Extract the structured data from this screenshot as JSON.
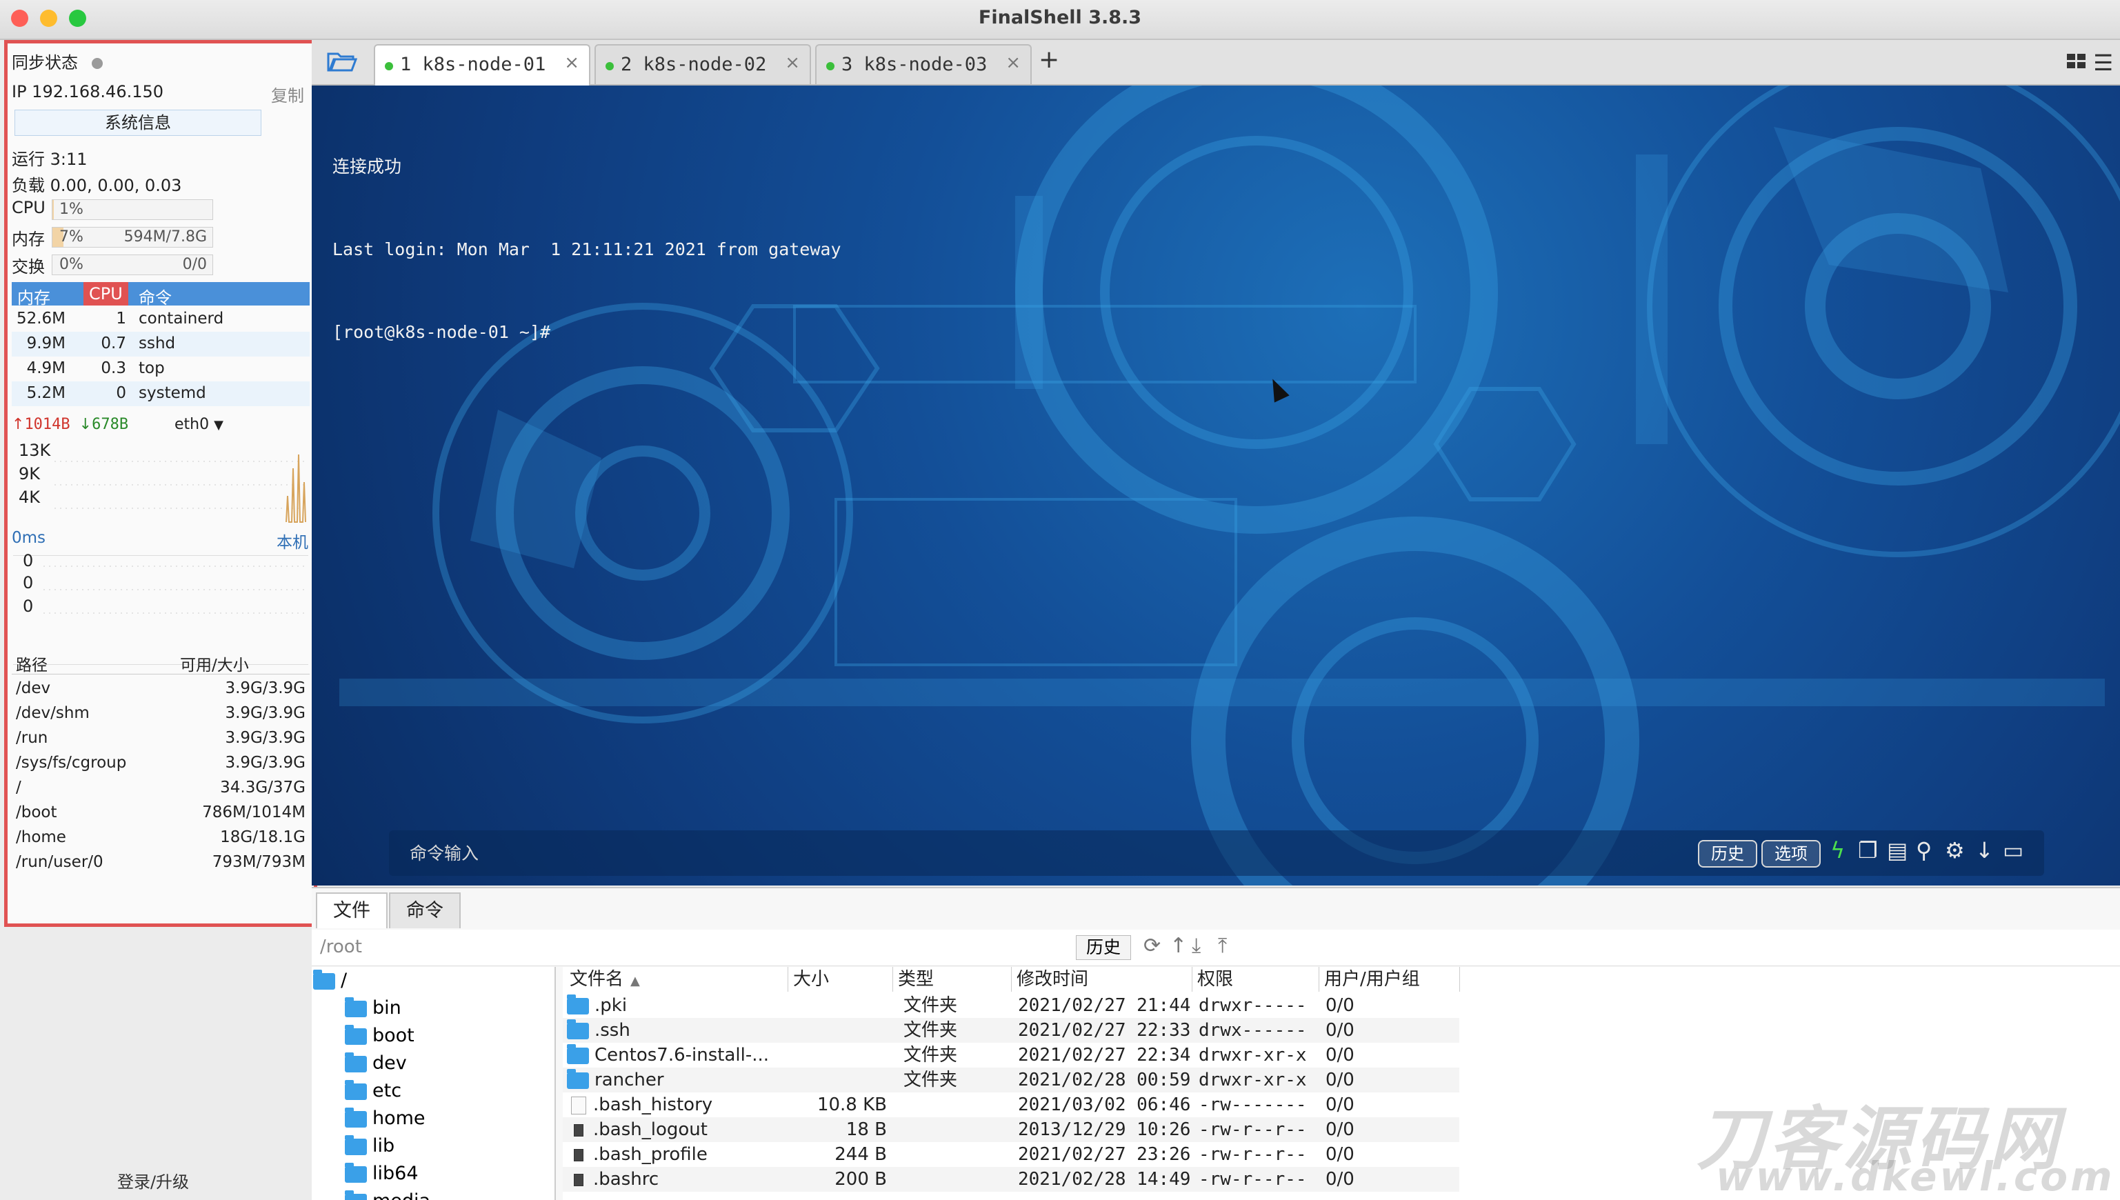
{
  "window": {
    "title": "FinalShell 3.8.3"
  },
  "sidebar": {
    "sync_status": "同步状态",
    "ip": "IP 192.168.46.150",
    "copy": "复制",
    "sysinfo_button": "系统信息",
    "uptime": "运行 3:11",
    "load": "负载 0.00, 0.00, 0.03",
    "cpu": {
      "label": "CPU",
      "value": "1%",
      "fraction": 0.01
    },
    "mem": {
      "label": "内存",
      "value": "7%",
      "detail": "594M/7.8G",
      "fraction": 0.07
    },
    "swap": {
      "label": "交换",
      "value": "0%",
      "detail": "0/0",
      "fraction": 0
    },
    "proc_headers": [
      "内存",
      "CPU",
      "命令"
    ],
    "processes": [
      {
        "mem": "52.6M",
        "cpu": "1",
        "cmd": "containerd"
      },
      {
        "mem": "9.9M",
        "cpu": "0.7",
        "cmd": "sshd"
      },
      {
        "mem": "4.9M",
        "cpu": "0.3",
        "cmd": "top"
      },
      {
        "mem": "5.2M",
        "cpu": "0",
        "cmd": "systemd"
      }
    ],
    "net": {
      "up": "1014B",
      "down": "678B",
      "iface": "eth0",
      "scale": [
        "13K",
        "9K",
        "4K"
      ]
    },
    "ping": {
      "latency": "0ms",
      "target": "本机",
      "values": [
        "0",
        "0",
        "0"
      ]
    },
    "disk_headers": [
      "路径",
      "可用/大小"
    ],
    "disks": [
      {
        "path": "/dev",
        "size": "3.9G/3.9G"
      },
      {
        "path": "/dev/shm",
        "size": "3.9G/3.9G"
      },
      {
        "path": "/run",
        "size": "3.9G/3.9G"
      },
      {
        "path": "/sys/fs/cgroup",
        "size": "3.9G/3.9G"
      },
      {
        "path": "/",
        "size": "34.3G/37G"
      },
      {
        "path": "/boot",
        "size": "786M/1014M"
      },
      {
        "path": "/home",
        "size": "18G/18.1G"
      },
      {
        "path": "/run/user/0",
        "size": "793M/793M"
      }
    ],
    "login": "登录/升级"
  },
  "tabs": [
    {
      "label": "1 k8s-node-01",
      "active": true
    },
    {
      "label": "2 k8s-node-02",
      "active": false
    },
    {
      "label": "3 k8s-node-03",
      "active": false
    }
  ],
  "terminal": {
    "lines": [
      "连接成功",
      "Last login: Mon Mar  1 21:11:21 2021 from gateway",
      "[root@k8s-node-01 ~]#"
    ],
    "command_placeholder": "命令输入",
    "history_btn": "历史",
    "options_btn": "选项"
  },
  "bottom": {
    "tabs": [
      "文件",
      "命令"
    ],
    "path": "/root",
    "history_btn": "历史",
    "tree": [
      "/",
      "bin",
      "boot",
      "dev",
      "etc",
      "home",
      "lib",
      "lib64",
      "media"
    ],
    "columns": [
      "文件名",
      "大小",
      "类型",
      "修改时间",
      "权限",
      "用户/用户组"
    ],
    "files": [
      {
        "name": ".pki",
        "size": "",
        "type": "文件夹",
        "mtime": "2021/02/27 21:44",
        "perm": "drwxr-----",
        "owner": "0/0",
        "kind": "folder"
      },
      {
        "name": ".ssh",
        "size": "",
        "type": "文件夹",
        "mtime": "2021/02/27 22:33",
        "perm": "drwx------",
        "owner": "0/0",
        "kind": "folder"
      },
      {
        "name": "Centos7.6-install-...",
        "size": "",
        "type": "文件夹",
        "mtime": "2021/02/27 22:34",
        "perm": "drwxr-xr-x",
        "owner": "0/0",
        "kind": "folder"
      },
      {
        "name": "rancher",
        "size": "",
        "type": "文件夹",
        "mtime": "2021/02/28 00:59",
        "perm": "drwxr-xr-x",
        "owner": "0/0",
        "kind": "folder"
      },
      {
        "name": ".bash_history",
        "size": "10.8 KB",
        "type": "",
        "mtime": "2021/03/02 06:46",
        "perm": "-rw-------",
        "owner": "0/0",
        "kind": "file"
      },
      {
        "name": ".bash_logout",
        "size": "18 B",
        "type": "",
        "mtime": "2013/12/29 10:26",
        "perm": "-rw-r--r--",
        "owner": "0/0",
        "kind": "dark"
      },
      {
        "name": ".bash_profile",
        "size": "244 B",
        "type": "",
        "mtime": "2021/02/27 23:26",
        "perm": "-rw-r--r--",
        "owner": "0/0",
        "kind": "dark"
      },
      {
        "name": ".bashrc",
        "size": "200 B",
        "type": "",
        "mtime": "2021/02/28 14:49",
        "perm": "-rw-r--r--",
        "owner": "0/0",
        "kind": "dark"
      }
    ]
  },
  "watermark": {
    "line1": "刀客源码网",
    "line2": "www.dkewl.com"
  },
  "colors": {
    "accent": "#4a90d9",
    "highlight_border": "#e05252",
    "terminal_bg": "#134f98",
    "online_dot": "#3bbf3b"
  }
}
